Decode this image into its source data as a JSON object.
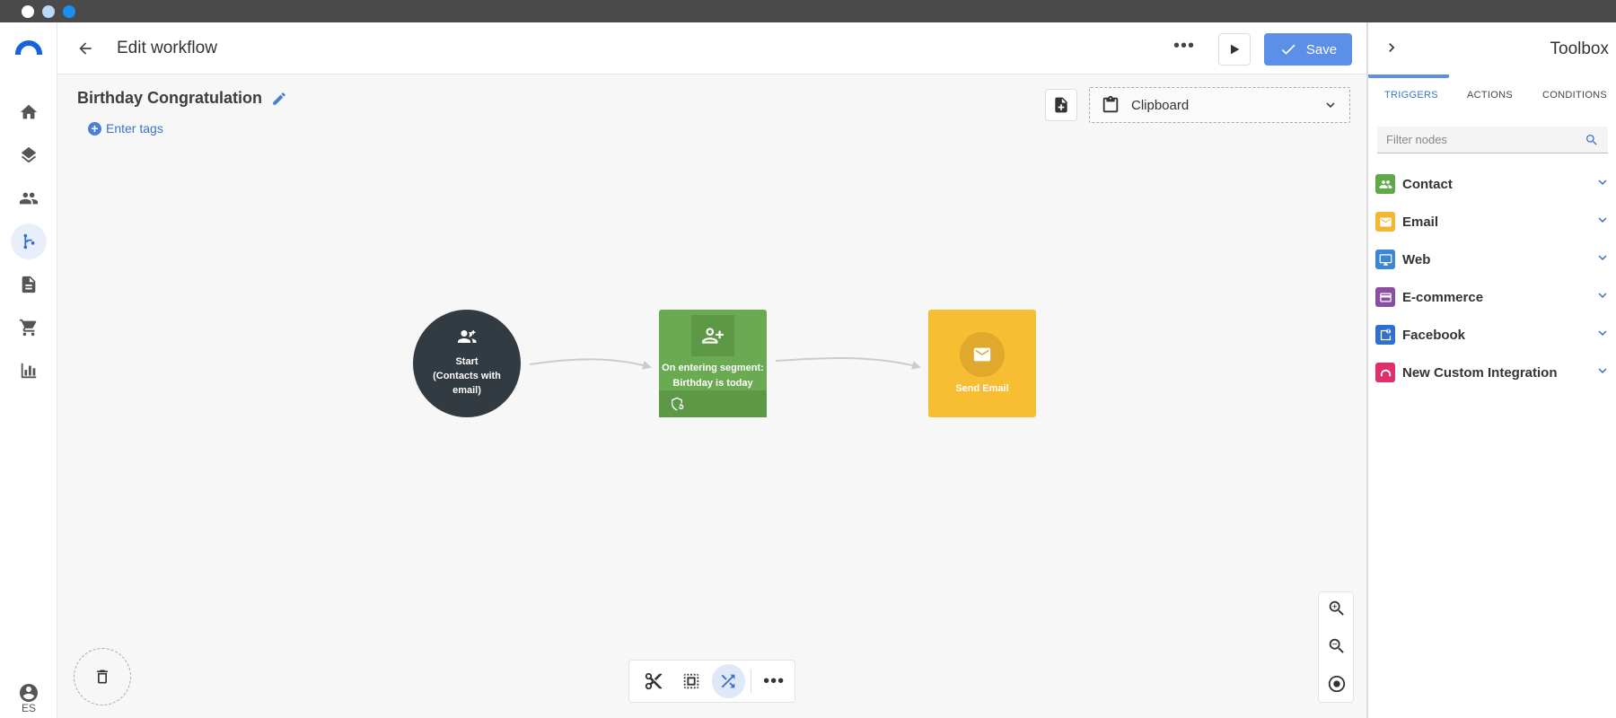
{
  "window": {
    "dots": [
      "#ffffff",
      "#b9daf6",
      "#1b8ef0"
    ]
  },
  "nav": {
    "items": [
      {
        "name": "home-icon",
        "active": false
      },
      {
        "name": "layers-icon",
        "active": false
      },
      {
        "name": "contacts-icon",
        "active": false
      },
      {
        "name": "workflow-icon",
        "active": true
      },
      {
        "name": "document-icon",
        "active": false
      },
      {
        "name": "cart-icon",
        "active": false
      },
      {
        "name": "chart-icon",
        "active": false
      }
    ],
    "user_icon": "account-icon",
    "language": "ES"
  },
  "header": {
    "title": "Edit workflow",
    "save_label": "Save"
  },
  "workflow": {
    "name": "Birthday Congratulation",
    "tags_label": "Enter tags",
    "clipboard_label": "Clipboard"
  },
  "nodes": {
    "start": {
      "line1": "Start",
      "line2": "(Contacts with",
      "line3": "email)",
      "color": "#323a42"
    },
    "segment": {
      "line1": "On entering segment:",
      "line2": "Birthday is today",
      "color": "#6aaa52"
    },
    "email": {
      "label": "Send Email",
      "color": "#f7bd33"
    }
  },
  "toolbox": {
    "title": "Toolbox",
    "tabs": [
      "TRIGGERS",
      "ACTIONS",
      "CONDITIONS"
    ],
    "active_tab": "TRIGGERS",
    "filter_placeholder": "Filter nodes",
    "categories": [
      {
        "label": "Contact",
        "color": "#5fa94a",
        "icon": "contact-icon"
      },
      {
        "label": "Email",
        "color": "#f2b632",
        "icon": "email-icon"
      },
      {
        "label": "Web",
        "color": "#3e86d1",
        "icon": "monitor-icon"
      },
      {
        "label": "E-commerce",
        "color": "#8a4fa0",
        "icon": "credit-card-icon"
      },
      {
        "label": "Facebook",
        "color": "#2f6fd4",
        "icon": "facebook-icon"
      },
      {
        "label": "New Custom Integration",
        "color": "#e0306a",
        "icon": "integration-icon"
      }
    ]
  },
  "colors": {
    "accent": "#5b8fe8",
    "canvas": "#f7f7f7"
  }
}
